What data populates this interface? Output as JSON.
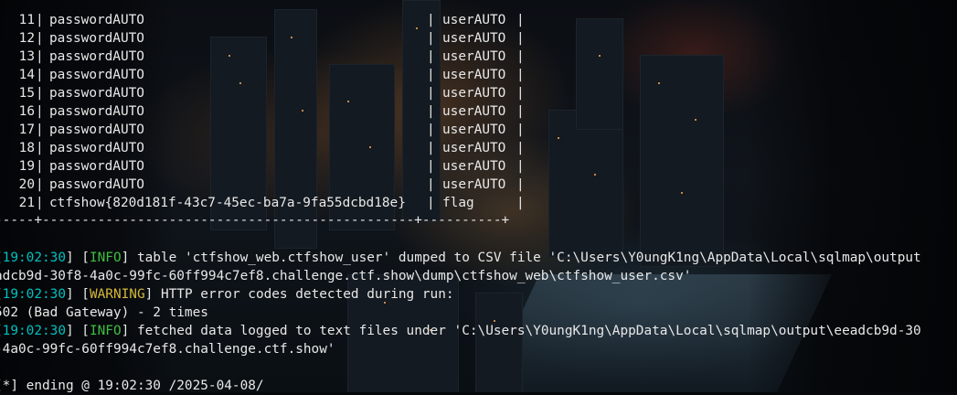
{
  "colors": {
    "text": "#e8e8e8",
    "timestamp": "#00c0c0",
    "info_tag": "#3fbf3f",
    "warning_tag": "#d6b73a",
    "background": "#06080c"
  },
  "table": {
    "rows": [
      {
        "id": "11",
        "password": "passwordAUTO",
        "username": "userAUTO"
      },
      {
        "id": "12",
        "password": "passwordAUTO",
        "username": "userAUTO"
      },
      {
        "id": "13",
        "password": "passwordAUTO",
        "username": "userAUTO"
      },
      {
        "id": "14",
        "password": "passwordAUTO",
        "username": "userAUTO"
      },
      {
        "id": "15",
        "password": "passwordAUTO",
        "username": "userAUTO"
      },
      {
        "id": "16",
        "password": "passwordAUTO",
        "username": "userAUTO"
      },
      {
        "id": "17",
        "password": "passwordAUTO",
        "username": "userAUTO"
      },
      {
        "id": "18",
        "password": "passwordAUTO",
        "username": "userAUTO"
      },
      {
        "id": "19",
        "password": "passwordAUTO",
        "username": "userAUTO"
      },
      {
        "id": "20",
        "password": "passwordAUTO",
        "username": "userAUTO"
      },
      {
        "id": "21",
        "password": "ctfshow{820d181f-43c7-45ec-ba7a-9fa55dcbd18e}",
        "username": "flag"
      }
    ],
    "separator": "|",
    "bottom_border": "-----+-----------------------------------------------+----------+"
  },
  "log": {
    "l1": {
      "time": "19:02:30",
      "tag": "INFO",
      "text": " table 'ctfshow_web.ctfshow_user' dumped to CSV file 'C:\\Users\\Y0ungK1ng\\AppData\\Local\\sqlmap\\output"
    },
    "l1_cont": "adcb9d-30f8-4a0c-99fc-60ff994c7ef8.challenge.ctf.show\\dump\\ctfshow_web\\ctfshow_user.csv'",
    "l2": {
      "time": "19:02:30",
      "tag": "WARNING",
      "text": " HTTP error codes detected during run:"
    },
    "l2_cont": "502 (Bad Gateway) - 2 times",
    "l3": {
      "time": "19:02:30",
      "tag": "INFO",
      "text": " fetched data logged to text files under 'C:\\Users\\Y0ungK1ng\\AppData\\Local\\sqlmap\\output\\eeadcb9d-30"
    },
    "l3_cont": "-4a0c-99fc-60ff994c7ef8.challenge.ctf.show'",
    "ending": "[*] ending @ 19:02:30 /2025-04-08/"
  }
}
